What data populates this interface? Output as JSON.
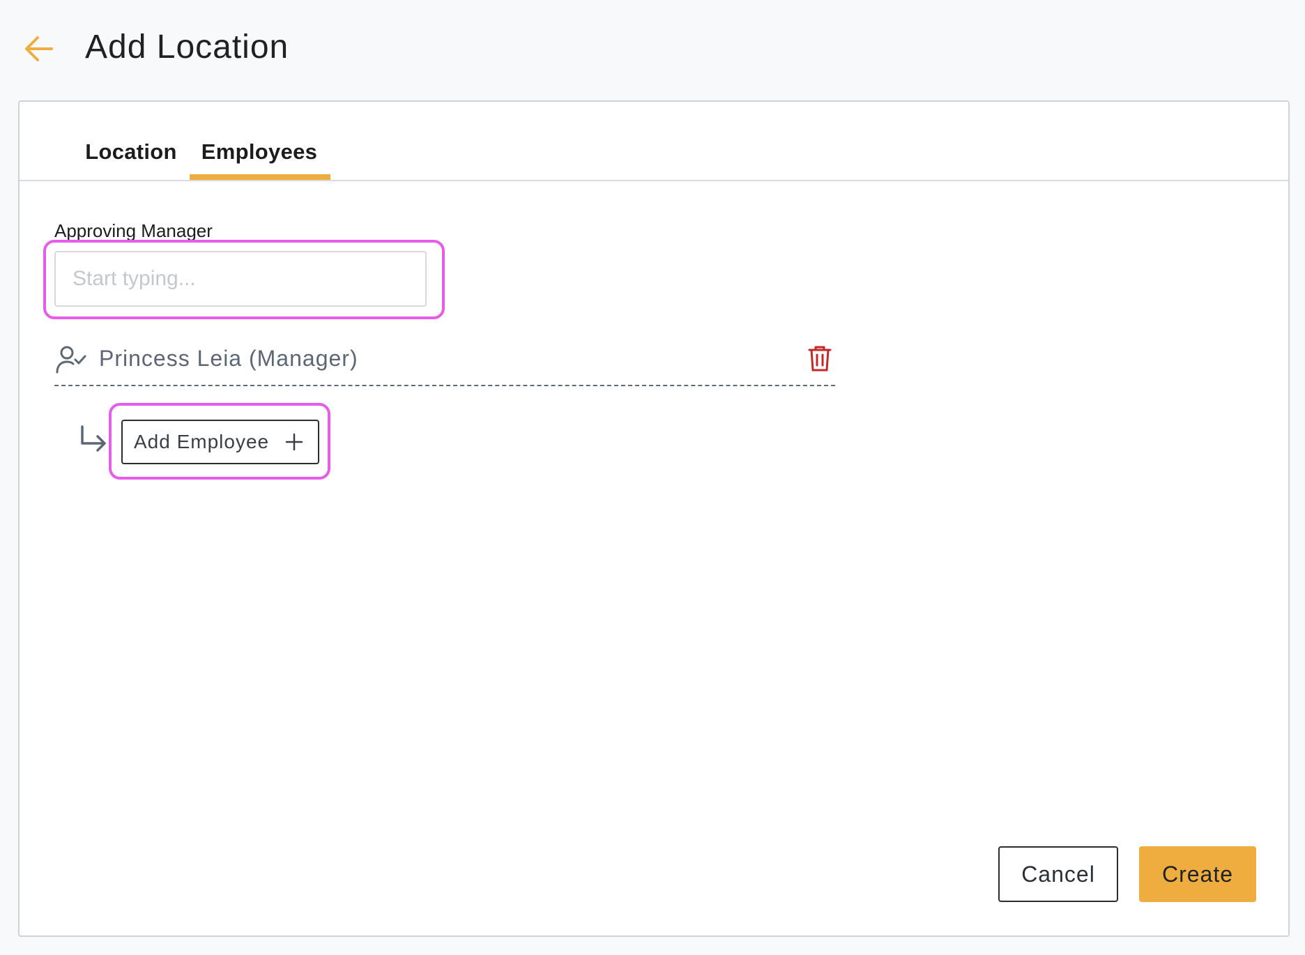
{
  "header": {
    "title": "Add Location",
    "back_icon": "arrow-left-icon",
    "accent_color": "#f0ad3f"
  },
  "tabs": [
    {
      "label": "Location",
      "active": false
    },
    {
      "label": "Employees",
      "active": true
    }
  ],
  "form": {
    "approving_manager_label": "Approving Manager",
    "approving_manager_placeholder": "Start typing...",
    "approving_manager_value": ""
  },
  "manager": {
    "name": "Princess Leia (Manager)",
    "icon": "user-check-icon",
    "delete_icon": "trash-icon",
    "delete_color": "#c62828"
  },
  "add_employee": {
    "label": "Add Employee",
    "icon": "plus-icon",
    "connector_icon": "return-arrow-icon"
  },
  "actions": {
    "cancel_label": "Cancel",
    "create_label": "Create"
  },
  "highlight_color": "#e55de8"
}
